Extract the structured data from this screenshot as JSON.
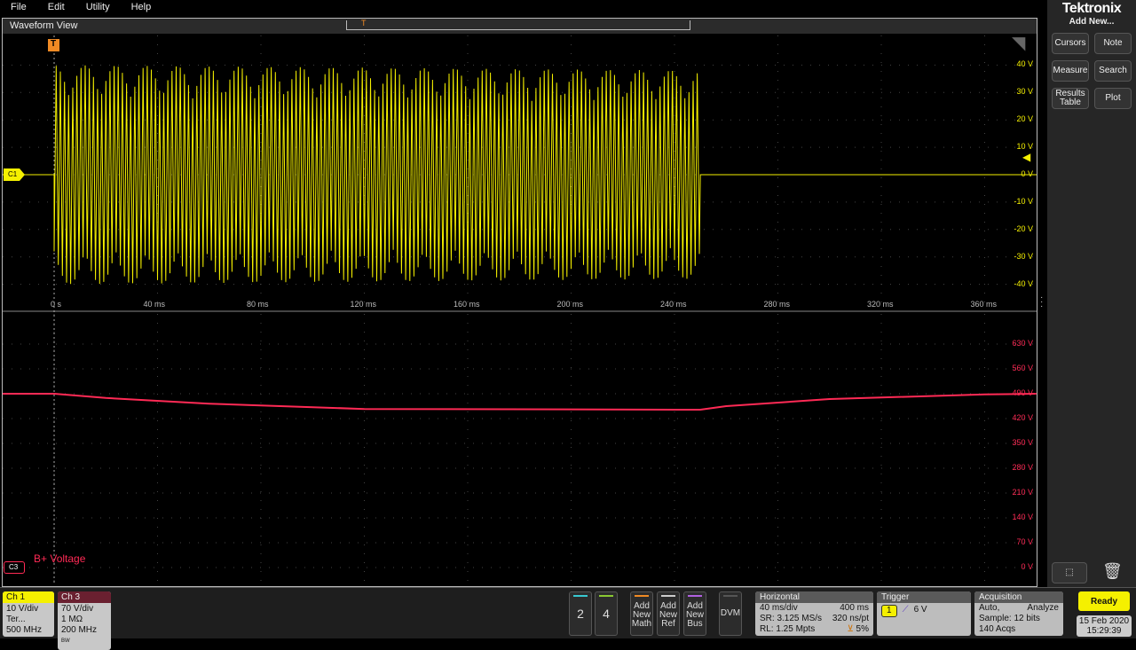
{
  "menu": [
    "File",
    "Edit",
    "Utility",
    "Help"
  ],
  "waveform_view": {
    "title": "Waveform View"
  },
  "upper_plot": {
    "channel_label": "C1",
    "color": "#f5f000",
    "y_labels": [
      "40 V",
      "30 V",
      "20 V",
      "10 V",
      "0 V",
      "-10 V",
      "-20 V",
      "-30 V",
      "-40 V"
    ],
    "x_labels": [
      "0 s",
      "40 ms",
      "80 ms",
      "120 ms",
      "160 ms",
      "200 ms",
      "240 ms",
      "280 ms",
      "320 ms",
      "360 ms"
    ],
    "burst_start_ms": 0,
    "burst_end_ms": 250,
    "burst_amplitude_v": 40
  },
  "lower_plot": {
    "channel_label": "C3",
    "color": "#ff2a55",
    "series_label": "B+ Voltage",
    "y_labels": [
      "630 V",
      "560 V",
      "490 V",
      "420 V",
      "350 V",
      "280 V",
      "210 V",
      "140 V",
      "70 V",
      "0 V"
    ],
    "trace": [
      [
        -60,
        490
      ],
      [
        0,
        490
      ],
      [
        20,
        478
      ],
      [
        60,
        462
      ],
      [
        120,
        447
      ],
      [
        250,
        445
      ],
      [
        260,
        455
      ],
      [
        300,
        475
      ],
      [
        360,
        488
      ],
      [
        380,
        490
      ]
    ]
  },
  "trigger_marker": "T",
  "right_panel": {
    "brand": "Tektronix",
    "add_new": "Add New...",
    "buttons": [
      "Cursors",
      "Note",
      "Measure",
      "Search",
      "Results Table",
      "Plot"
    ]
  },
  "channels": [
    {
      "name": "Ch 1",
      "lines": [
        "10 V/div",
        "Ter...",
        "500 MHz"
      ],
      "color": "#f5f000"
    },
    {
      "name": "Ch 3",
      "lines": [
        "70 V/div",
        "1 MΩ",
        "200 MHz"
      ],
      "color": "#6a2030",
      "bw": "BW"
    }
  ],
  "inactive_channels": [
    {
      "label": "2",
      "color": "#38c8d0"
    },
    {
      "label": "4",
      "color": "#8ac832"
    }
  ],
  "add_buttons": [
    {
      "label": "Add New Math",
      "color": "#f08a24"
    },
    {
      "label": "Add New Ref",
      "color": "#cccccc"
    },
    {
      "label": "Add New Bus",
      "color": "#b060e0"
    }
  ],
  "dvm": "DVM",
  "horizontal": {
    "title": "Horizontal",
    "scale": "40 ms/div",
    "position": "400 ms",
    "sr": "SR: 3.125 MS/s",
    "pt": "320 ns/pt",
    "rl": "RL: 1.25 Mpts",
    "delay": "5%"
  },
  "trigger": {
    "title": "Trigger",
    "source": "1",
    "level": "6 V"
  },
  "acquisition": {
    "title": "Acquisition",
    "mode": "Auto,",
    "analyze": "Analyze",
    "sample": "Sample: 12 bits",
    "acqs": "140 Acqs"
  },
  "status": {
    "state": "Ready",
    "date": "15 Feb 2020",
    "time": "15:29:39"
  }
}
